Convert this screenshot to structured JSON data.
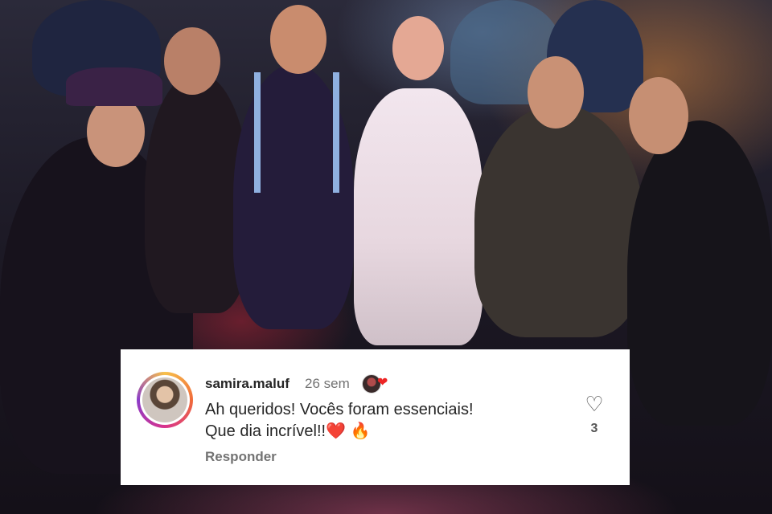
{
  "background": {
    "description_icon": "group-photo"
  },
  "comment": {
    "username": "samira.maluf",
    "time_ago": "26 sem",
    "text_line1": "Ah queridos! Vocês foram essenciais!",
    "text_line2": "Que dia incrível!!❤️ 🔥",
    "reply_label": "Responder",
    "like_count": "3",
    "creator_heart": "❤",
    "like_icon": "♡"
  },
  "colors": {
    "username": "#262626",
    "muted": "#737373",
    "heart_red": "#ed2424"
  }
}
